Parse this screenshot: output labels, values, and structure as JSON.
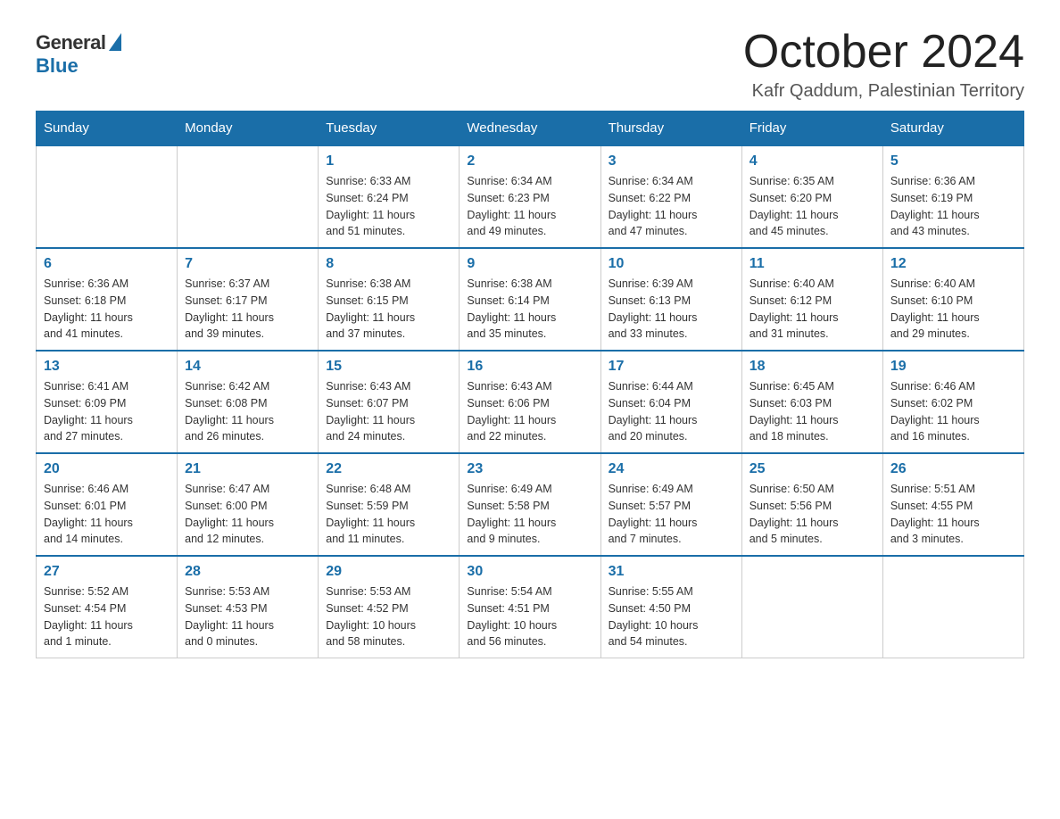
{
  "header": {
    "logo_general": "General",
    "logo_blue": "Blue",
    "month_title": "October 2024",
    "location": "Kafr Qaddum, Palestinian Territory"
  },
  "weekdays": [
    "Sunday",
    "Monday",
    "Tuesday",
    "Wednesday",
    "Thursday",
    "Friday",
    "Saturday"
  ],
  "weeks": [
    [
      {
        "day": "",
        "info": ""
      },
      {
        "day": "",
        "info": ""
      },
      {
        "day": "1",
        "info": "Sunrise: 6:33 AM\nSunset: 6:24 PM\nDaylight: 11 hours\nand 51 minutes."
      },
      {
        "day": "2",
        "info": "Sunrise: 6:34 AM\nSunset: 6:23 PM\nDaylight: 11 hours\nand 49 minutes."
      },
      {
        "day": "3",
        "info": "Sunrise: 6:34 AM\nSunset: 6:22 PM\nDaylight: 11 hours\nand 47 minutes."
      },
      {
        "day": "4",
        "info": "Sunrise: 6:35 AM\nSunset: 6:20 PM\nDaylight: 11 hours\nand 45 minutes."
      },
      {
        "day": "5",
        "info": "Sunrise: 6:36 AM\nSunset: 6:19 PM\nDaylight: 11 hours\nand 43 minutes."
      }
    ],
    [
      {
        "day": "6",
        "info": "Sunrise: 6:36 AM\nSunset: 6:18 PM\nDaylight: 11 hours\nand 41 minutes."
      },
      {
        "day": "7",
        "info": "Sunrise: 6:37 AM\nSunset: 6:17 PM\nDaylight: 11 hours\nand 39 minutes."
      },
      {
        "day": "8",
        "info": "Sunrise: 6:38 AM\nSunset: 6:15 PM\nDaylight: 11 hours\nand 37 minutes."
      },
      {
        "day": "9",
        "info": "Sunrise: 6:38 AM\nSunset: 6:14 PM\nDaylight: 11 hours\nand 35 minutes."
      },
      {
        "day": "10",
        "info": "Sunrise: 6:39 AM\nSunset: 6:13 PM\nDaylight: 11 hours\nand 33 minutes."
      },
      {
        "day": "11",
        "info": "Sunrise: 6:40 AM\nSunset: 6:12 PM\nDaylight: 11 hours\nand 31 minutes."
      },
      {
        "day": "12",
        "info": "Sunrise: 6:40 AM\nSunset: 6:10 PM\nDaylight: 11 hours\nand 29 minutes."
      }
    ],
    [
      {
        "day": "13",
        "info": "Sunrise: 6:41 AM\nSunset: 6:09 PM\nDaylight: 11 hours\nand 27 minutes."
      },
      {
        "day": "14",
        "info": "Sunrise: 6:42 AM\nSunset: 6:08 PM\nDaylight: 11 hours\nand 26 minutes."
      },
      {
        "day": "15",
        "info": "Sunrise: 6:43 AM\nSunset: 6:07 PM\nDaylight: 11 hours\nand 24 minutes."
      },
      {
        "day": "16",
        "info": "Sunrise: 6:43 AM\nSunset: 6:06 PM\nDaylight: 11 hours\nand 22 minutes."
      },
      {
        "day": "17",
        "info": "Sunrise: 6:44 AM\nSunset: 6:04 PM\nDaylight: 11 hours\nand 20 minutes."
      },
      {
        "day": "18",
        "info": "Sunrise: 6:45 AM\nSunset: 6:03 PM\nDaylight: 11 hours\nand 18 minutes."
      },
      {
        "day": "19",
        "info": "Sunrise: 6:46 AM\nSunset: 6:02 PM\nDaylight: 11 hours\nand 16 minutes."
      }
    ],
    [
      {
        "day": "20",
        "info": "Sunrise: 6:46 AM\nSunset: 6:01 PM\nDaylight: 11 hours\nand 14 minutes."
      },
      {
        "day": "21",
        "info": "Sunrise: 6:47 AM\nSunset: 6:00 PM\nDaylight: 11 hours\nand 12 minutes."
      },
      {
        "day": "22",
        "info": "Sunrise: 6:48 AM\nSunset: 5:59 PM\nDaylight: 11 hours\nand 11 minutes."
      },
      {
        "day": "23",
        "info": "Sunrise: 6:49 AM\nSunset: 5:58 PM\nDaylight: 11 hours\nand 9 minutes."
      },
      {
        "day": "24",
        "info": "Sunrise: 6:49 AM\nSunset: 5:57 PM\nDaylight: 11 hours\nand 7 minutes."
      },
      {
        "day": "25",
        "info": "Sunrise: 6:50 AM\nSunset: 5:56 PM\nDaylight: 11 hours\nand 5 minutes."
      },
      {
        "day": "26",
        "info": "Sunrise: 5:51 AM\nSunset: 4:55 PM\nDaylight: 11 hours\nand 3 minutes."
      }
    ],
    [
      {
        "day": "27",
        "info": "Sunrise: 5:52 AM\nSunset: 4:54 PM\nDaylight: 11 hours\nand 1 minute."
      },
      {
        "day": "28",
        "info": "Sunrise: 5:53 AM\nSunset: 4:53 PM\nDaylight: 11 hours\nand 0 minutes."
      },
      {
        "day": "29",
        "info": "Sunrise: 5:53 AM\nSunset: 4:52 PM\nDaylight: 10 hours\nand 58 minutes."
      },
      {
        "day": "30",
        "info": "Sunrise: 5:54 AM\nSunset: 4:51 PM\nDaylight: 10 hours\nand 56 minutes."
      },
      {
        "day": "31",
        "info": "Sunrise: 5:55 AM\nSunset: 4:50 PM\nDaylight: 10 hours\nand 54 minutes."
      },
      {
        "day": "",
        "info": ""
      },
      {
        "day": "",
        "info": ""
      }
    ]
  ]
}
